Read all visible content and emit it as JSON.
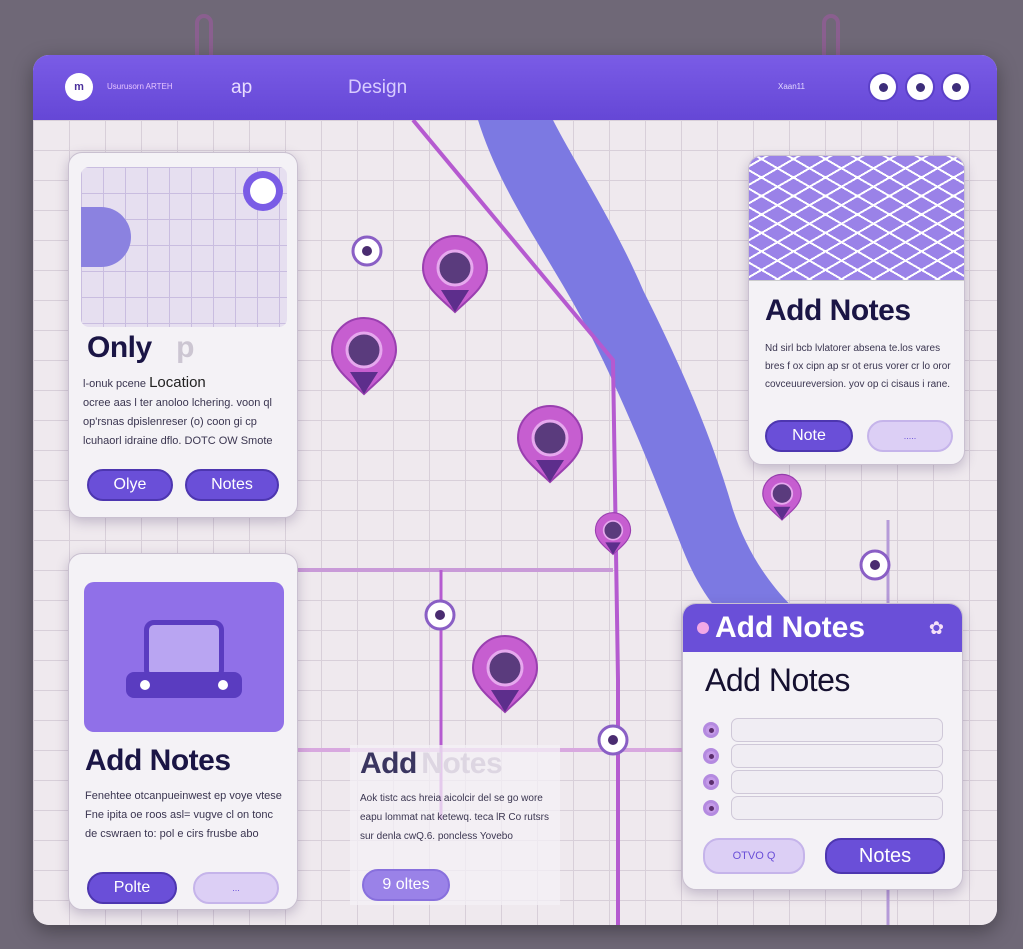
{
  "header": {
    "logo": "m",
    "brand": "Usurusorn ARTEH",
    "title_map": "ap",
    "title_design": "Design",
    "small_text": "Xaan11",
    "buttons": [
      "shield-icon",
      "pin-icon",
      "target-icon"
    ]
  },
  "card_location": {
    "title": "Only",
    "title_faded": "p",
    "subtitle": "Location",
    "lead": "l-onuk pcene",
    "body": "ocree aas l ter anoloo lchering. voon ql op'rsnas dpislenreser (o) coon gi cp lcuhaorl idraine dflo. DOTC OW Smote",
    "btn1": "Olye",
    "btn2": "Notes"
  },
  "card_car": {
    "title": "Add Notes",
    "body": "Fenehtee otcanpueinwest ep voye vtese Fne ipita oe roos asl= vugve cl on tonc de cswraen to: pol e cirs frusbe abo",
    "btn1": "Polte",
    "btn2": "..."
  },
  "card_faded": {
    "title": "Add",
    "title_faded": "Notes",
    "body": "Aok tistc acs hreia aicolcir del se go wore eapu lommat nat ketewq. teca lR Co rutsrs sur denla cwQ.6. poncless Yovebo",
    "btn1": "9 oltes"
  },
  "card_notes_right": {
    "title": "Add Notes",
    "body": "Nd sirl bcb lvlatorer absena te.los vares bres f ox cipn ap sr ot erus vorer cr lo oror covceuureversion. yov op ci cisaus i rane.",
    "btn1": "Note",
    "btn2": "....."
  },
  "panel": {
    "header_title": "Add Notes",
    "title": "Add Notes",
    "fields": [
      "",
      "",
      "",
      ""
    ],
    "btn_secondary": "OTVO Q",
    "btn_primary": "Notes"
  },
  "colors": {
    "accent": "#6a4fd8",
    "pin": "#c45fcf",
    "river": "#7a78e0"
  }
}
